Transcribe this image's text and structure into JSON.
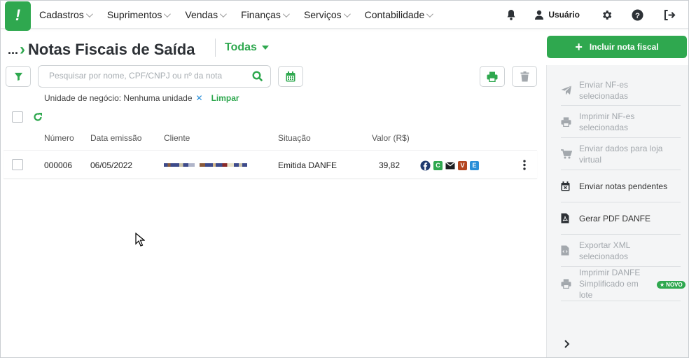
{
  "nav": {
    "menu": [
      "Cadastros",
      "Suprimentos",
      "Vendas",
      "Finanças",
      "Serviços",
      "Contabilidade"
    ],
    "user_label": "Usuário",
    "icons": [
      "bell-icon",
      "user-icon",
      "gear-icon",
      "help-icon",
      "logout-icon"
    ]
  },
  "header": {
    "breadcrumb_dots": "...",
    "title": "Notas Fiscais de Saída",
    "filter_dropdown": "Todas"
  },
  "search": {
    "placeholder": "Pesquisar por nome, CPF/CNPJ ou nº da nota",
    "value": ""
  },
  "filters": {
    "active": "Unidade de negócio: Nenhuma unidade",
    "remove": "✕",
    "clear": "Limpar"
  },
  "table": {
    "columns": [
      "Número",
      "Data emissão",
      "Cliente",
      "Situação",
      "Valor (R$)"
    ],
    "rows": [
      {
        "numero": "000006",
        "data": "06/05/2022",
        "cliente": "",
        "situacao": "Emitida DANFE",
        "valor": "39,82",
        "badges": [
          "C",
          "V",
          "E"
        ]
      }
    ]
  },
  "actions": {
    "primary": "Incluir nota fiscal",
    "list": [
      {
        "label": "Enviar NF-es selecionadas",
        "icon": "send-icon",
        "enabled": false
      },
      {
        "label": "Imprimir NF-es selecionadas",
        "icon": "printer-icon",
        "enabled": false
      },
      {
        "label": "Enviar dados para loja virtual",
        "icon": "cart-icon",
        "enabled": false
      },
      {
        "label": "Enviar notas pendentes",
        "icon": "calendar-x-icon",
        "enabled": true
      },
      {
        "label": "Gerar PDF DANFE",
        "icon": "pdf-icon",
        "enabled": true
      },
      {
        "label": "Exportar XML selecionados",
        "icon": "xml-file-icon",
        "enabled": false
      },
      {
        "label": "Imprimir DANFE Simplificado em lote",
        "icon": "printer-icon",
        "enabled": false
      }
    ],
    "new_badge": "NOVO"
  },
  "colors": {
    "brand": "#2fa84f",
    "text": "#2d3136",
    "muted": "#a3a8ad",
    "link_x": "#2a8fd8"
  }
}
